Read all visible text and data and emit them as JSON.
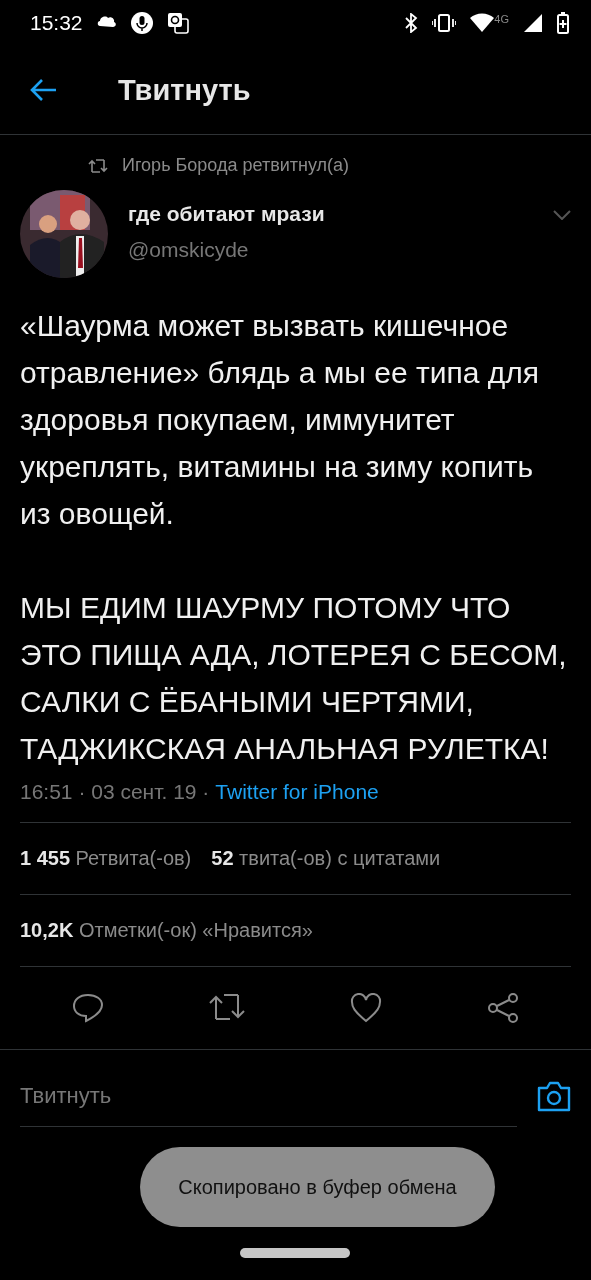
{
  "status_bar": {
    "time": "15:32",
    "network": "4G"
  },
  "header": {
    "title": "Твитнуть"
  },
  "retweeted_by": "Игорь Борода ретвитнул(а)",
  "author": {
    "name": "где обитают мрази",
    "handle": "@omskicyde"
  },
  "tweet": {
    "paragraphs": [
      "«Шаурма может вызвать кишечное отравление» блядь а мы ее типа для здоровья покупаем, иммунитет укреплять, витамины на зиму копить из овощей.",
      "МЫ ЕДИМ ШАУРМУ ПОТОМУ ЧТО ЭТО ПИЩА АДА, ЛОТЕРЕЯ С БЕСОМ, САЛКИ С ЁБАНЫМИ ЧЕРТЯМИ, ТАДЖИКСКАЯ АНАЛЬНАЯ РУЛЕТКА!"
    ],
    "meta": "16:51 · 03 сент. 19 ·",
    "source": "Twitter for iPhone"
  },
  "stats": [
    "**1 455** Ретвита(-ов)",
    "**52** твита(-ов) с цитатами"
  ],
  "likes": "**10,2K** Отметки(-ок) «Нравится»",
  "reply": {
    "placeholder": "Твитнуть"
  },
  "toast": "Скопировано в буфер обмена"
}
